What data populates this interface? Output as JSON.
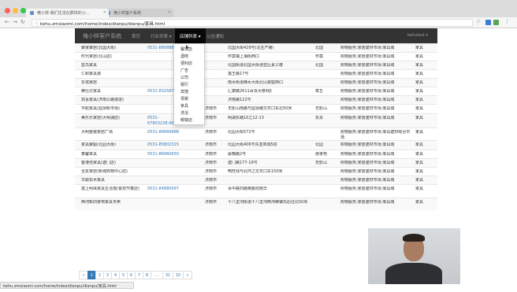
{
  "browser": {
    "tabs": [
      {
        "label": "俺小样-我们生活在那样的小..."
      },
      {
        "label": "俺小样客户系统"
      }
    ],
    "url": "kehu.zmxiaomi.com/home/index/dianpu/dianpu/家具.html",
    "status_url": "kehu.zmxiaomi.com/home/index/dianpu/dianpu/家具.html"
  },
  "appnav": {
    "brand": "俺小样客户系统",
    "items": [
      {
        "label": "首页"
      },
      {
        "label": "行业列表 ▾"
      },
      {
        "label": "店铺列表 ▾"
      },
      {
        "label": "公告通知"
      }
    ],
    "user": "kehutest ▾"
  },
  "dropdown": {
    "items": [
      "餐饮店",
      "酒吧",
      "便利店",
      "广告",
      "公司",
      "银行",
      "宾馆",
      "母婴",
      "家具",
      "洗浴",
      "眼镜店"
    ]
  },
  "table": {
    "rows": [
      {
        "name": "聚家聚居(北国大街)",
        "phone": "0531-8808881",
        "city": "",
        "addr": "北国大街429号(北生产路)",
        "dist": "北国",
        "biz": "购物服务;家居建材市场;家具城",
        "cat": "家具"
      },
      {
        "name": "时代家居(北山店)",
        "phone": "",
        "city": "",
        "addr": "怀莫镇上海街西口",
        "dist": "怀莫",
        "biz": "购物服务;家居建材市场;家具城",
        "cat": "家具"
      },
      {
        "name": "蓝鸟家具",
        "phone": "",
        "city": "",
        "addr": "北国街道北国大街道亚区素三楼",
        "dist": "北国",
        "biz": "购物服务;家居建材市场;家具城",
        "cat": "家具"
      },
      {
        "name": "仁和家具城",
        "phone": "",
        "city": "",
        "addr": "莲王路17号",
        "dist": "",
        "biz": "购物服务;家居建材市场;家具城",
        "cat": "家具"
      },
      {
        "name": "东塔家居",
        "phone": "",
        "city": "",
        "addr": "南水街道峰水大街北山家庭西口",
        "dist": "",
        "biz": "购物服务;家居建材市场;家具城",
        "cat": "家具"
      },
      {
        "name": "腾仕达家具",
        "phone": "0531-8325875",
        "city": "",
        "addr": "汇康路2611百货大楼4层",
        "dist": "章丘",
        "biz": "购物服务;家居建材市场;家具城",
        "cat": "家具"
      },
      {
        "name": "双喜家具(济南公路城道)",
        "phone": "",
        "city": "",
        "addr": "济南路122号",
        "dist": "",
        "biz": "购物服务;家居建材市场;家具城",
        "cat": "家具"
      },
      {
        "name": "字航家具(监狱新市场)",
        "phone": "",
        "city": "济南市",
        "addr": "无影山南路与监狱路交叉口东北50米",
        "dist": "无影山",
        "biz": "购物服务;家居建材市场;家具城",
        "cat": "家具"
      },
      {
        "name": "美乐乐家居(大明湖店)",
        "phone": "0531-67803228;4000088888",
        "city": "济南市",
        "addr": "明湖东路10之12-13",
        "dist": "东关",
        "biz": "购物服务;家居建材市场;家具城",
        "cat": "家具"
      },
      {
        "name": "大明整装家居广场",
        "phone": "0531-86666888",
        "city": "济南市",
        "addr": "北园大街572号",
        "dist": "",
        "biz": "购物服务;家居建材市场;家具建材综合市场",
        "cat": "家具"
      },
      {
        "name": "家具聚超(北园大街)",
        "phone": "0531-85802315",
        "city": "济南市",
        "addr": "北园大街406号东亚商城5层",
        "dist": "北园",
        "biz": "购物服务;家居建材市场;家具城",
        "cat": "家具"
      },
      {
        "name": "泰馨家具",
        "phone": "0531-86960650",
        "city": "济南市",
        "addr": "蔡鞠路2号",
        "dist": "惠家苑",
        "biz": "购物服务;家居建材市场;家具城",
        "cat": "家具"
      },
      {
        "name": "客港佳家具(建门店)",
        "phone": "",
        "city": "济南市",
        "addr": "建门路177-19号",
        "dist": "无影山",
        "biz": "购物服务;家居建材市场;家具城",
        "cat": "家具"
      },
      {
        "name": "全友家居(新城购物中心店)",
        "phone": "",
        "city": "济南市",
        "addr": "鸭旺线与北环之交叉口东150米",
        "dist": "",
        "biz": "购物服务;家居建材市场;家具城",
        "cat": "家具"
      },
      {
        "name": "华联松木家具",
        "phone": "",
        "city": "济南市",
        "addr": "",
        "dist": "",
        "biz": "购物服务;家居建材市场;家具城",
        "cat": "家具"
      },
      {
        "name": "富上明珠家具生活馆(曹双节奏店)",
        "phone": "0531-84880097",
        "city": "济南市",
        "addr": "青中路扫路奥都坊南华",
        "dist": "",
        "biz": "购物服务;家居建材市场;家具城",
        "cat": "家具"
      },
      {
        "name": "西河新旧家电家具专卖",
        "phone": "",
        "city": "济南市",
        "addr": "十八里河街道十八里河西河峰镇先后往北50米",
        "dist": "",
        "biz": "购物服务;家居建材市场;家具城",
        "cat": "家具"
      }
    ]
  },
  "pagination": {
    "items": [
      "«",
      "1",
      "2",
      "3",
      "4",
      "5",
      "6",
      "7",
      "8",
      "…",
      "31",
      "32",
      "»"
    ],
    "active": "1"
  },
  "colors": {
    "navbar": "#333333",
    "link": "#337ab7",
    "pager_active": "#337ab7"
  }
}
